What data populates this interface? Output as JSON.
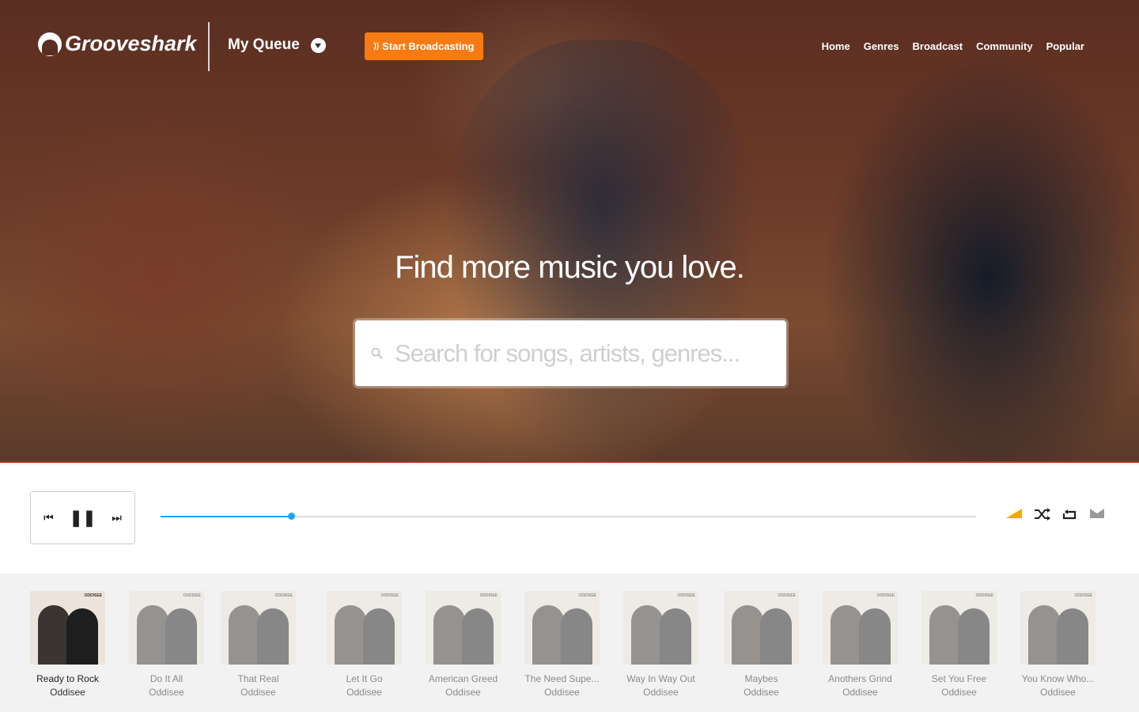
{
  "header": {
    "logo": "Grooveshark",
    "queue_label": "My Queue",
    "broadcast_label": "Start Broadcasting",
    "nav": [
      "Home",
      "Genres",
      "Broadcast",
      "Community",
      "Popular"
    ]
  },
  "hero": {
    "tagline": "Find more music you love.",
    "search_placeholder": "Search for songs, artists, genres..."
  },
  "player": {
    "progress_percent": 16,
    "accent": "#1aa6f5",
    "volume_color": "#f5a800",
    "icons": [
      "previous-icon",
      "pause-icon",
      "next-icon",
      "volume-icon",
      "shuffle-icon",
      "repeat-icon",
      "crossfade-icon"
    ]
  },
  "queue": {
    "items": [
      {
        "song": "Ready to Rock",
        "artist": "Oddisee",
        "active": true
      },
      {
        "song": "Do It All",
        "artist": "Oddisee"
      },
      {
        "song": "That Real",
        "artist": "Oddisee"
      },
      {
        "song": "Let It Go",
        "artist": "Oddisee"
      },
      {
        "song": "American Greed",
        "artist": "Oddisee"
      },
      {
        "song": "The Need Supe...",
        "artist": "Oddisee"
      },
      {
        "song": "Way In Way Out",
        "artist": "Oddisee"
      },
      {
        "song": "Maybes",
        "artist": "Oddisee"
      },
      {
        "song": "Anothers Grind",
        "artist": "Oddisee"
      },
      {
        "song": "Set You Free",
        "artist": "Oddisee"
      },
      {
        "song": "You Know Who...",
        "artist": "Oddisee"
      }
    ],
    "album_art_text": "ODDISEE"
  },
  "colors": {
    "broadcast": "#f77b12"
  }
}
